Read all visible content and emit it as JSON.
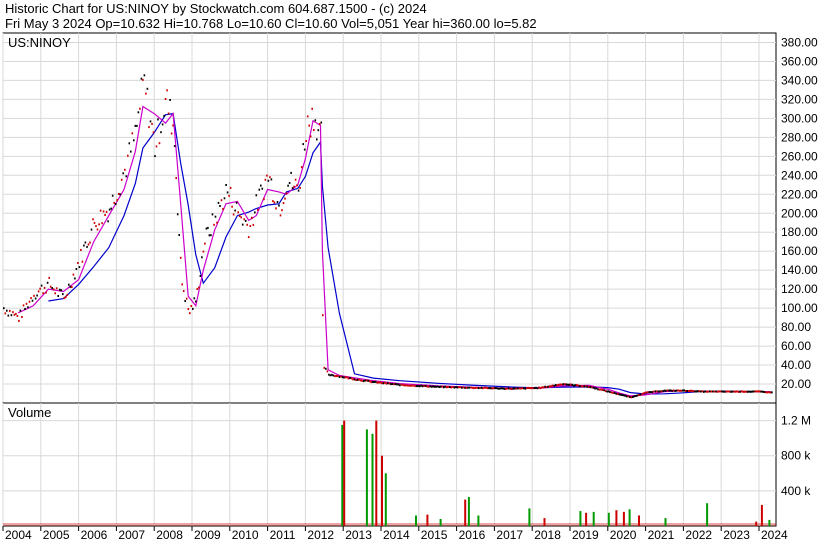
{
  "header": {
    "line1": "Historic Chart for US:NINOY by Stockwatch.com 604.687.1500 - (c) 2024",
    "line2": "Fri May  3 2024   Op=10.632   Hi=10.768   Lo=10.60   Cl=10.60   Vol=5,051   Year hi=360.00   lo=5.82"
  },
  "chart_data": [
    {
      "type": "line",
      "title": "US:NINOY",
      "ylim": [
        0,
        390
      ],
      "y_ticks": [
        "20.00",
        "40.00",
        "60.00",
        "80.00",
        "100.00",
        "120.00",
        "140.00",
        "160.00",
        "180.00",
        "200.00",
        "220.00",
        "240.00",
        "260.00",
        "280.00",
        "300.00",
        "320.00",
        "340.00",
        "360.00",
        "380.00"
      ],
      "grid": true,
      "x": [
        2004.0,
        2004.4,
        2004.8,
        2005.2,
        2005.6,
        2006.0,
        2006.4,
        2006.8,
        2007.2,
        2007.5,
        2007.7,
        2008.0,
        2008.3,
        2008.5,
        2008.7,
        2008.9,
        2009.1,
        2009.3,
        2009.6,
        2009.9,
        2010.2,
        2010.5,
        2010.7,
        2011.0,
        2011.3,
        2011.5,
        2011.8,
        2012.0,
        2012.2,
        2012.4,
        2012.45,
        2012.6,
        2012.9,
        2013.3,
        2013.8,
        2014.5,
        2015.5,
        2016.5,
        2017.5,
        2018.2,
        2018.8,
        2019.5,
        2020.0,
        2020.3,
        2020.6,
        2021.0,
        2021.5,
        2022.0,
        2022.5,
        2023.0,
        2023.5,
        2024.0,
        2024.33
      ],
      "series": [
        {
          "color": "#000000",
          "style": "price",
          "values": [
            100,
            90,
            115,
            125,
            110,
            150,
            190,
            205,
            245,
            285,
            340,
            270,
            320,
            290,
            130,
            95,
            110,
            170,
            195,
            225,
            200,
            185,
            210,
            240,
            205,
            235,
            225,
            290,
            305,
            280,
            40,
            30,
            28,
            25,
            22,
            19,
            17,
            16,
            15,
            16,
            20,
            17,
            12,
            9,
            6,
            11,
            13,
            13,
            12,
            12,
            12,
            12,
            11
          ]
        },
        {
          "color": "#cc0000",
          "style": "price",
          "values": []
        },
        {
          "color": "#cc00cc",
          "style": "ma",
          "values": []
        },
        {
          "color": "#0000cc",
          "style": "ma",
          "values": []
        }
      ]
    },
    {
      "type": "bar",
      "title": "Volume",
      "ylim": [
        0,
        1400000
      ],
      "y_ticks": [
        "400 k",
        "800 k",
        "1.2 M"
      ],
      "x_ticks": [
        "2004",
        "2005",
        "2006",
        "2007",
        "2008",
        "2009",
        "2010",
        "2011",
        "2012",
        "2013",
        "2014",
        "2015",
        "2016",
        "2017",
        "2018",
        "2019",
        "2020",
        "2021",
        "2022",
        "2023",
        "2024"
      ],
      "bars": [
        {
          "x": 2012.95,
          "v": 1150000,
          "c": "#009900"
        },
        {
          "x": 2013.0,
          "v": 1200000,
          "c": "#cc0000"
        },
        {
          "x": 2013.6,
          "v": 1100000,
          "c": "#009900"
        },
        {
          "x": 2013.75,
          "v": 1050000,
          "c": "#009900"
        },
        {
          "x": 2013.85,
          "v": 1200000,
          "c": "#cc0000"
        },
        {
          "x": 2014.0,
          "v": 800000,
          "c": "#cc0000"
        },
        {
          "x": 2014.1,
          "v": 600000,
          "c": "#009900"
        },
        {
          "x": 2014.9,
          "v": 120000,
          "c": "#009900"
        },
        {
          "x": 2015.2,
          "v": 130000,
          "c": "#cc0000"
        },
        {
          "x": 2015.55,
          "v": 80000,
          "c": "#009900"
        },
        {
          "x": 2016.2,
          "v": 300000,
          "c": "#cc0000"
        },
        {
          "x": 2016.3,
          "v": 330000,
          "c": "#009900"
        },
        {
          "x": 2016.55,
          "v": 120000,
          "c": "#009900"
        },
        {
          "x": 2017.9,
          "v": 200000,
          "c": "#009900"
        },
        {
          "x": 2018.3,
          "v": 90000,
          "c": "#cc0000"
        },
        {
          "x": 2019.25,
          "v": 170000,
          "c": "#009900"
        },
        {
          "x": 2019.4,
          "v": 150000,
          "c": "#cc0000"
        },
        {
          "x": 2019.6,
          "v": 160000,
          "c": "#009900"
        },
        {
          "x": 2020.0,
          "v": 150000,
          "c": "#009900"
        },
        {
          "x": 2020.2,
          "v": 180000,
          "c": "#cc0000"
        },
        {
          "x": 2020.4,
          "v": 160000,
          "c": "#cc0000"
        },
        {
          "x": 2020.55,
          "v": 190000,
          "c": "#009900"
        },
        {
          "x": 2020.8,
          "v": 120000,
          "c": "#cc0000"
        },
        {
          "x": 2021.5,
          "v": 90000,
          "c": "#009900"
        },
        {
          "x": 2022.6,
          "v": 260000,
          "c": "#009900"
        },
        {
          "x": 2023.9,
          "v": 50000,
          "c": "#cc0000"
        },
        {
          "x": 2024.05,
          "v": 240000,
          "c": "#cc0000"
        },
        {
          "x": 2024.25,
          "v": 70000,
          "c": "#009900"
        }
      ]
    }
  ]
}
